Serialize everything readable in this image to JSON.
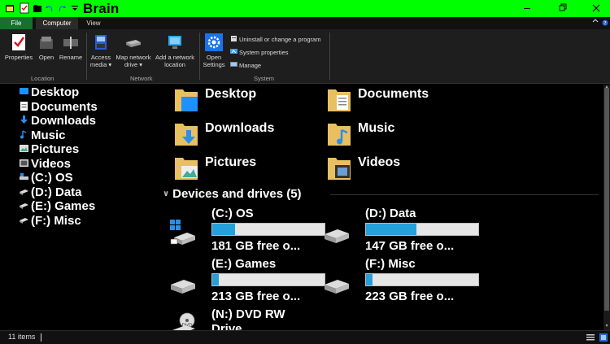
{
  "window": {
    "title": "Brain",
    "accent": "#00ff00"
  },
  "ribbon_tabs": [
    "File",
    "Computer",
    "View"
  ],
  "ribbon": {
    "location": {
      "label": "Location",
      "buttons": [
        "Properties",
        "Open",
        "Rename"
      ]
    },
    "network": {
      "label": "Network",
      "access_media": [
        "Access",
        "media ▾"
      ],
      "map_network_drive": [
        "Map network",
        "drive ▾"
      ],
      "add_network_location": [
        "Add a network",
        "location"
      ]
    },
    "system": {
      "label": "System",
      "open_settings": [
        "Open",
        "Settings"
      ],
      "uninstall": "Uninstall or change a program",
      "system_properties": "System properties",
      "manage": "Manage"
    }
  },
  "nav": {
    "items": [
      "Desktop",
      "Documents",
      "Downloads",
      "Music",
      "Pictures",
      "Videos",
      "(C:) OS",
      "(D:) Data",
      "(E:) Games",
      "(F:) Misc"
    ]
  },
  "folders": [
    "Desktop",
    "Documents",
    "Downloads",
    "Music",
    "Pictures",
    "Videos"
  ],
  "devices": {
    "header": "Devices and drives (5)",
    "drives": [
      {
        "name": "(C:) OS",
        "free": "181 GB free o...",
        "used_fraction": 0.2
      },
      {
        "name": "(D:) Data",
        "free": "147 GB free o...",
        "used_fraction": 0.45
      },
      {
        "name": "(E:) Games",
        "free": "213 GB free o...",
        "used_fraction": 0.06
      },
      {
        "name": "(F:) Misc",
        "free": "223 GB free o...",
        "used_fraction": 0.06
      },
      {
        "name": "(N:) DVD RW",
        "free": "Drive"
      }
    ]
  },
  "status": {
    "items": "11 items"
  },
  "colors": {
    "drive_bar": "#26a0da",
    "folder": "#e8c062"
  }
}
